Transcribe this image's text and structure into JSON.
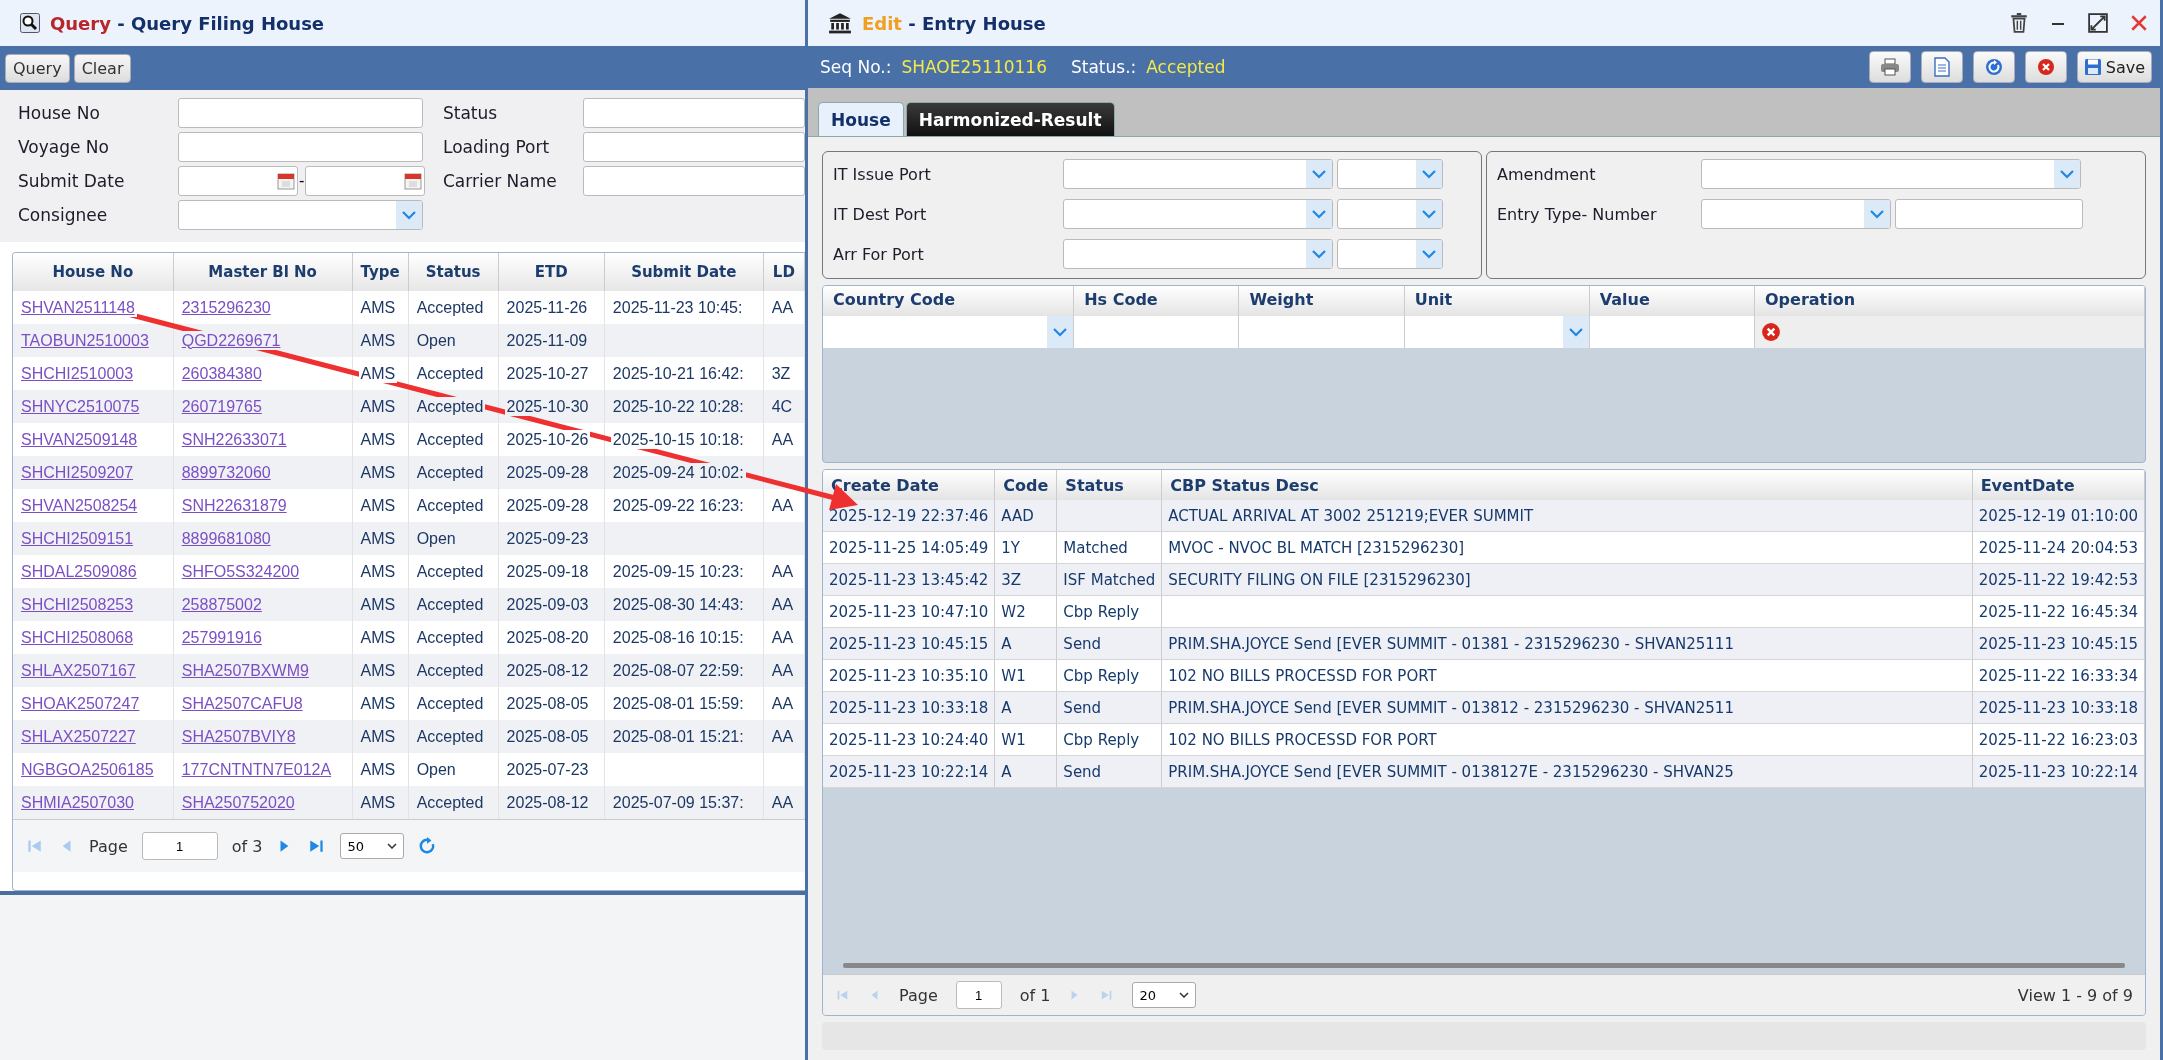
{
  "query_window": {
    "title_prefix": "Query",
    "title_separator": "-",
    "title": "Query Filing House",
    "buttons": [
      "Query",
      "Clear"
    ],
    "fields": [
      {
        "label": "House No",
        "kind": "text"
      },
      {
        "label": "Status",
        "kind": "text"
      },
      {
        "label": "Voyage No",
        "kind": "text"
      },
      {
        "label": "Loading Port",
        "kind": "text"
      },
      {
        "label": "Submit Date",
        "kind": "daterange",
        "separator": "-"
      },
      {
        "label": "Carrier Name",
        "kind": "text"
      },
      {
        "label": "Consignee",
        "kind": "select"
      }
    ],
    "table": {
      "columns": [
        "House No",
        "Master Bl No",
        "Type",
        "Status",
        "ETD",
        "Submit Date",
        "LD"
      ],
      "rows": [
        {
          "house_no": "SHVAN2511148",
          "master_bl_no": "2315296230",
          "type": "AMS",
          "status": "Accepted",
          "etd": "2025-11-26",
          "submit_date": "2025-11-23 10:45:",
          "column_7": "AA"
        },
        {
          "house_no": "TAOBUN2510003",
          "master_bl_no": "QGD2269671",
          "type": "AMS",
          "status": "Open",
          "etd": "2025-11-09"
        },
        {
          "house_no": "SHCHI2510003",
          "master_bl_no": "260384380",
          "type": "AMS",
          "status": "Accepted",
          "etd": "2025-10-27",
          "submit_date": "2025-10-21 16:42:",
          "column_7": "3Z"
        },
        {
          "house_no": "SHNYC2510075",
          "master_bl_no": "260719765",
          "type": "AMS",
          "status": "Accepted",
          "etd": "2025-10-30",
          "submit_date": "2025-10-22 10:28:",
          "column_7": "4C"
        },
        {
          "house_no": "SHVAN2509148",
          "master_bl_no": "SNH22633071",
          "type": "AMS",
          "status": "Accepted",
          "etd": "2025-10-26",
          "submit_date": "2025-10-15 10:18:",
          "column_7": "AA"
        },
        {
          "house_no": "SHCHI2509207",
          "master_bl_no": "8899732060",
          "type": "AMS",
          "status": "Accepted",
          "etd": "2025-09-28",
          "submit_date": "2025-09-24 10:02:"
        },
        {
          "house_no": "SHVAN2508254",
          "master_bl_no": "SNH22631879",
          "type": "AMS",
          "status": "Accepted",
          "etd": "2025-09-28",
          "submit_date": "2025-09-22 16:23:",
          "column_7": "AA"
        },
        {
          "house_no": "SHCHI2509151",
          "master_bl_no": "8899681080",
          "type": "AMS",
          "status": "Open",
          "etd": "2025-09-23"
        },
        {
          "house_no": "SHDAL2509086",
          "master_bl_no": "SHFO5S324200",
          "type": "AMS",
          "status": "Accepted",
          "etd": "2025-09-18",
          "submit_date": "2025-09-15 10:23:",
          "column_7": "AA"
        },
        {
          "house_no": "SHCHI2508253",
          "master_bl_no": "258875002",
          "type": "AMS",
          "status": "Accepted",
          "etd": "2025-09-03",
          "submit_date": "2025-08-30 14:43:",
          "column_7": "AA"
        },
        {
          "house_no": "SHCHI2508068",
          "master_bl_no": "257991916",
          "type": "AMS",
          "status": "Accepted",
          "etd": "2025-08-20",
          "submit_date": "2025-08-16 10:15:",
          "column_7": "AA"
        },
        {
          "house_no": "SHLAX2507167",
          "master_bl_no": "SHA2507BXWM9",
          "type": "AMS",
          "status": "Accepted",
          "etd": "2025-08-12",
          "submit_date": "2025-08-07 22:59:",
          "column_7": "AA"
        },
        {
          "house_no": "SHOAK2507247",
          "master_bl_no": "SHA2507CAFU8",
          "type": "AMS",
          "status": "Accepted",
          "etd": "2025-08-05",
          "submit_date": "2025-08-01 15:59:",
          "column_7": "AA"
        },
        {
          "house_no": "SHLAX2507227",
          "master_bl_no": "SHA2507BVIY8",
          "type": "AMS",
          "status": "Accepted",
          "etd": "2025-08-05",
          "submit_date": "2025-08-01 15:21:",
          "column_7": "AA"
        },
        {
          "house_no": "NGBGOA2506185",
          "master_bl_no": "177CNTNTN7E012A",
          "type": "AMS",
          "status": "Open",
          "etd": "2025-07-23"
        },
        {
          "house_no": "SHMIA2507030",
          "master_bl_no": "SHA250752020",
          "type": "AMS",
          "status": "Accepted",
          "etd": "2025-08-12",
          "submit_date": "2025-07-09 15:37:",
          "column_7": "AA"
        }
      ]
    },
    "pager": {
      "buttons": [
        {
          "kind": "first",
          "disabled": true
        },
        {
          "kind": "prev",
          "disabled": true
        },
        {
          "kind": "next",
          "disabled": false
        },
        {
          "kind": "last",
          "disabled": false
        }
      ],
      "page_label": "Page",
      "page": "1",
      "of": "of 3",
      "page_size": "50"
    }
  },
  "edit_window": {
    "title_prefix": "Edit",
    "title_separator": "-",
    "title": "Entry House",
    "seq_label": "Seq No.:",
    "seq_value": "SHAOE25110116",
    "status_label": "Status.:",
    "status_value": "Accepted",
    "save_label": "Save",
    "tabs": [
      {
        "label": "House",
        "selected": true
      },
      {
        "label": "Harmonized-Result",
        "selected": false
      }
    ],
    "port_fields": [
      "IT Issue Port",
      "IT Dest Port",
      "Arr For Port"
    ],
    "amendment_label": "Amendment",
    "entry_type_label": "Entry Type- Number",
    "hs_table": {
      "columns": [
        {
          "label": "Country Code",
          "kind": "select"
        },
        {
          "label": "Hs Code",
          "kind": "text"
        },
        {
          "label": "Weight",
          "kind": "text"
        },
        {
          "label": "Unit",
          "kind": "select"
        },
        {
          "label": "Value",
          "kind": "text"
        },
        {
          "label": "Operation",
          "kind": "action"
        }
      ]
    },
    "events": {
      "columns": [
        "Create Date",
        "Code",
        "Status",
        "CBP Status Desc",
        "EventDate"
      ],
      "rows": [
        {
          "create_date": "2025-12-19 22:37:46",
          "code": "AAD",
          "desc": "ACTUAL ARRIVAL AT 3002 251219;EVER SUMMIT",
          "event_date": "2025-12-19 01:10:00"
        },
        {
          "create_date": "2025-11-25 14:05:49",
          "code": "1Y",
          "status": "Matched",
          "desc": "MVOC - NVOC BL MATCH [2315296230]",
          "event_date": "2025-11-24 20:04:53"
        },
        {
          "create_date": "2025-11-23 13:45:42",
          "code": "3Z",
          "status": "ISF Matched",
          "desc": "SECURITY FILING ON FILE [2315296230]",
          "event_date": "2025-11-22 19:42:53"
        },
        {
          "create_date": "2025-11-23 10:47:10",
          "code": "W2",
          "status": "Cbp Reply",
          "event_date": "2025-11-22 16:45:34"
        },
        {
          "create_date": "2025-11-23 10:45:15",
          "code": "A",
          "status": "Send",
          "desc": "PRIM.SHA.JOYCE Send [EVER SUMMIT - 01381 - 2315296230 - SHVAN25111",
          "event_date": "2025-11-23 10:45:15"
        },
        {
          "create_date": "2025-11-23 10:35:10",
          "code": "W1",
          "status": "Cbp Reply",
          "desc": "102 NO BILLS PROCESSD FOR PORT",
          "event_date": "2025-11-22 16:33:34"
        },
        {
          "create_date": "2025-11-23 10:33:18",
          "code": "A",
          "status": "Send",
          "desc": "PRIM.SHA.JOYCE Send [EVER SUMMIT - 013812 - 2315296230 - SHVAN2511",
          "event_date": "2025-11-23 10:33:18"
        },
        {
          "create_date": "2025-11-23 10:24:40",
          "code": "W1",
          "status": "Cbp Reply",
          "desc": "102 NO BILLS PROCESSD FOR PORT",
          "event_date": "2025-11-22 16:23:03"
        },
        {
          "create_date": "2025-11-23 10:22:14",
          "code": "A",
          "status": "Send",
          "desc": "PRIM.SHA.JOYCE Send [EVER SUMMIT - 0138127E - 2315296230 - SHVAN25",
          "event_date": "2025-11-23 10:22:14"
        }
      ]
    },
    "pager": {
      "buttons": [
        {
          "kind": "first",
          "disabled": true
        },
        {
          "kind": "prev",
          "disabled": true
        },
        {
          "kind": "next",
          "disabled": true
        },
        {
          "kind": "last",
          "disabled": true
        }
      ],
      "page_label": "Page",
      "page": "1",
      "of": "of 1",
      "page_size": "20",
      "view": "View 1 - 9 of 9"
    }
  }
}
